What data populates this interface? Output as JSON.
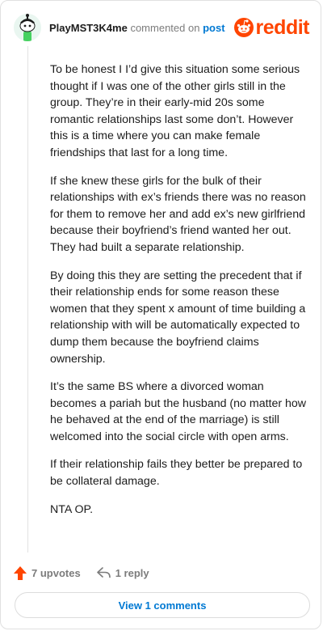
{
  "comment": {
    "username": "PlayMST3K4me",
    "commented_text": "commented on",
    "post_link": "post",
    "avatar_icon": "snoo-avatar-icon",
    "paragraphs": [
      "To be honest I I’d give this situation some serious thought if I was one of the other girls still in the group. They’re in their early-mid 20s some romantic relationships last some don’t. However this is a time where you can make female friendships that last for a long time.",
      "If she knew these girls for the bulk of their relationships with ex’s friends there was no reason for them to remove her and add ex’s new girlfriend because their boyfriend’s friend wanted her out. They had built a separate relationship.",
      "By doing this they are setting the precedent that if their relationship ends for some reason these women that they spent x amount of time building a relationship with will be automatically expected to dump them because the boyfriend claims ownership.",
      "It’s the same BS where a divorced woman becomes a pariah but the husband (no matter how he behaved at the end of the marriage) is still welcomed into the social circle with open arms.",
      "If their relationship fails they better be prepared to be collateral damage.",
      "NTA OP."
    ]
  },
  "brand": {
    "wordmark": "reddit",
    "logo_icon": "reddit-logo-icon",
    "color": "#ff4500"
  },
  "actions": {
    "upvotes": "7 upvotes",
    "upvote_icon": "upvote-arrow-icon",
    "reply": "1 reply",
    "reply_icon": "reply-arrow-icon"
  },
  "footer": {
    "view_comments": "View 1 comments"
  },
  "colors": {
    "link": "#0079d3",
    "upvote": "#ff4500",
    "muted": "#7c7c7c"
  }
}
